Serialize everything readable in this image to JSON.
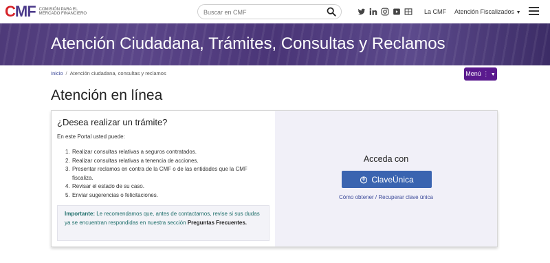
{
  "header": {
    "logo_mark": "CMF",
    "logo_text": "COMISIÓN PARA EL MERCADO FINANCIERO",
    "search_placeholder": "Buscar en CMF",
    "social_icons": [
      "twitter-icon",
      "linkedin-icon",
      "instagram-icon",
      "youtube-icon",
      "tv-icon"
    ],
    "nav_la_cmf": "La CMF",
    "nav_atencion": "Atención Fiscalizados",
    "accent_color": "#5a1a8e"
  },
  "banner": {
    "title": "Atención Ciudadana, Trámites, Consultas y Reclamos"
  },
  "breadcrumb": {
    "home": "Inicio",
    "separator": "/",
    "current": "Atención ciudadana, consultas y reclamos"
  },
  "menu_button": "Menú",
  "page_title": "Atención en línea",
  "card": {
    "heading": "¿Desea realizar un trámite?",
    "intro": "En este Portal usted puede:",
    "steps": [
      {
        "n": "1.",
        "text": "Realizar consultas relativas a seguros contratados."
      },
      {
        "n": "2.",
        "text": "Realizar consultas relativas a tenencia de acciones."
      },
      {
        "n": "3.",
        "text": "Presentar reclamos en contra de la CMF o de las entidades que la CMF fiscaliza."
      },
      {
        "n": "4.",
        "text": "Revisar el estado de su caso."
      },
      {
        "n": "5.",
        "text": "Enviar sugerencias o felicitaciones."
      }
    ],
    "note_label": "Importante:",
    "note_text": " Le recomendamos que, antes de contactarnos, revise si sus dudas ya se encuentran respondidas en nuestra sección ",
    "note_link": "Preguntas Frecuentes.",
    "acceda": "Acceda con",
    "clave_button": "ClaveÚnica",
    "clave_link": "Cómo obtener / Recuperar clave única"
  }
}
